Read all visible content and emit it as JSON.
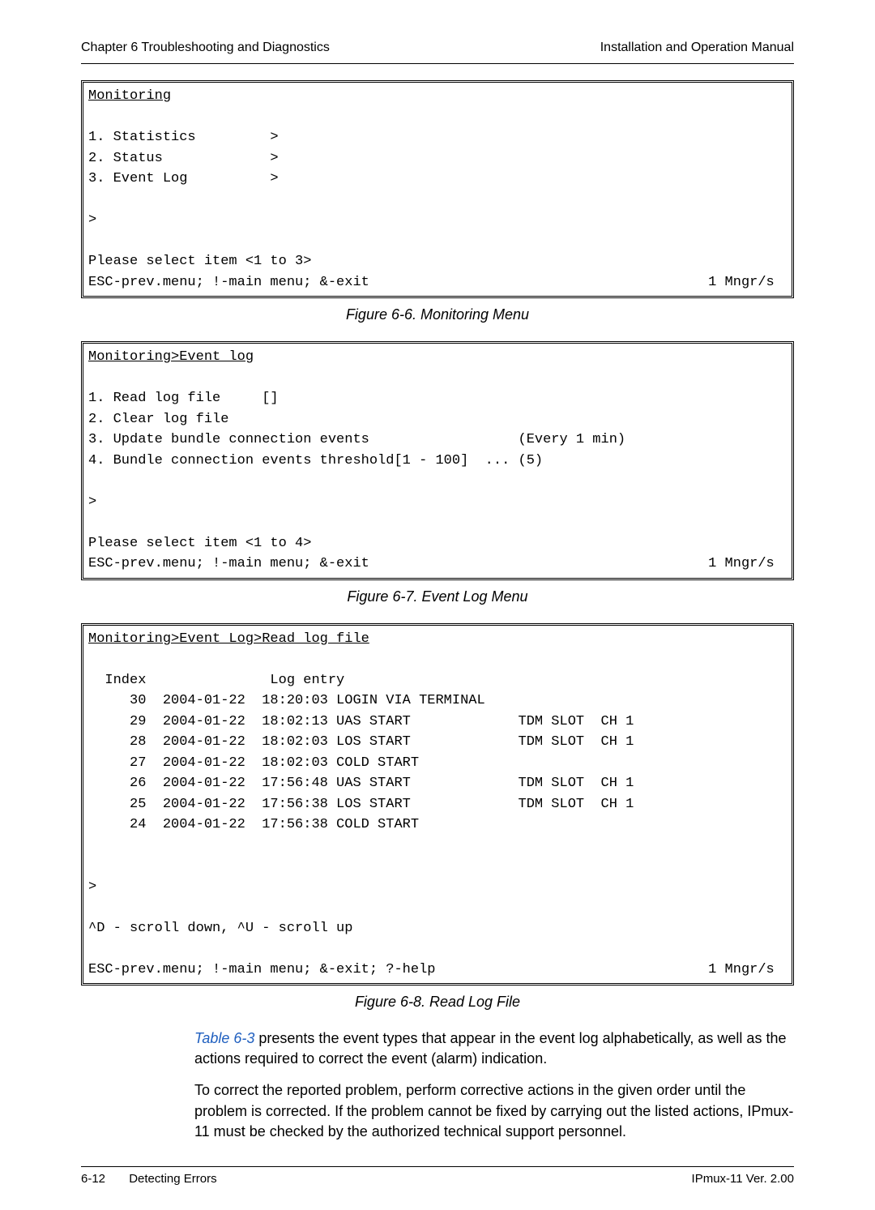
{
  "header": {
    "left": "Chapter 6  Troubleshooting and Diagnostics",
    "right": "Installation and Operation Manual"
  },
  "fig66": {
    "title": "Monitoring",
    "item1": "1. Statistics         >",
    "item2": "2. Status             >",
    "item3": "3. Event Log          >",
    "prompt": ">",
    "select": "Please select item <1 to 3>",
    "escLine": "ESC-prev.menu; !-main menu; &-exit",
    "mngr": "1 Mngr/s",
    "caption": "Figure 6-6.  Monitoring Menu"
  },
  "fig67": {
    "title": "Monitoring>Event log",
    "item1": "1. Read log file     []",
    "item2": "2. Clear log file",
    "item3": "3. Update bundle connection events                  (Every 1 min)",
    "item4": "4. Bundle connection events threshold[1 - 100]  ... (5)",
    "prompt": ">",
    "select": "Please select item <1 to 4>",
    "escLine": "ESC-prev.menu; !-main menu; &-exit",
    "mngr": "1 Mngr/s",
    "caption": "Figure 6-7.  Event Log Menu"
  },
  "fig68": {
    "title": "Monitoring>Event Log>Read log file",
    "hdr": "  Index               Log entry",
    "r30": "     30  2004-01-22  18:20:03 LOGIN VIA TERMINAL",
    "r29": "     29  2004-01-22  18:02:13 UAS START             TDM SLOT  CH 1",
    "r28": "     28  2004-01-22  18:02:03 LOS START             TDM SLOT  CH 1",
    "r27": "     27  2004-01-22  18:02:03 COLD START",
    "r26": "     26  2004-01-22  17:56:48 UAS START             TDM SLOT  CH 1",
    "r25": "     25  2004-01-22  17:56:38 LOS START             TDM SLOT  CH 1",
    "r24": "     24  2004-01-22  17:56:38 COLD START",
    "prompt": ">",
    "scroll": "^D - scroll down, ^U - scroll up",
    "escLine": "ESC-prev.menu; !-main menu; &-exit; ?-help",
    "mngr": "1 Mngr/s",
    "caption": "Figure 6-8.  Read Log File"
  },
  "para1_ref": "Table 6-3",
  "para1_rest": " presents the event types that appear in the event log alphabetically, as well as the actions required to correct the event (alarm) indication.",
  "para2": "To correct the reported problem, perform corrective actions in the given order until the problem is corrected. If the problem cannot be fixed by carrying out the listed actions, IPmux-11 must be checked by the authorized technical support personnel.",
  "footer": {
    "pagenum": "6-12",
    "section": "Detecting Errors",
    "product": "IPmux-11 Ver. 2.00"
  }
}
